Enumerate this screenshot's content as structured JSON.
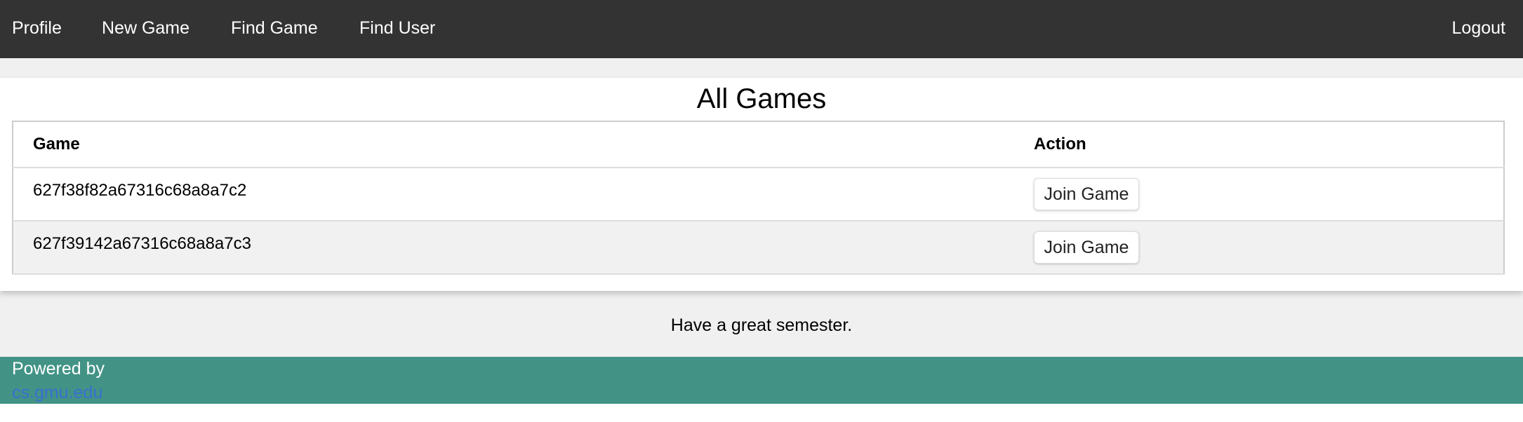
{
  "nav": {
    "items": [
      "Profile",
      "New Game",
      "Find Game",
      "Find User"
    ],
    "logout": "Logout"
  },
  "main": {
    "title": "All Games",
    "columns": [
      "Game",
      "Action"
    ],
    "rows": [
      {
        "game": "627f38f82a67316c68a8a7c2",
        "action": "Join Game"
      },
      {
        "game": "627f39142a67316c68a8a7c3",
        "action": "Join Game"
      }
    ],
    "message": "Have a great semester."
  },
  "footer": {
    "powered_by": "Powered by",
    "link": "cs.gmu.edu"
  },
  "colors": {
    "nav_bg": "#333333",
    "footer_bg": "#429386",
    "link": "#3a6fcf"
  }
}
